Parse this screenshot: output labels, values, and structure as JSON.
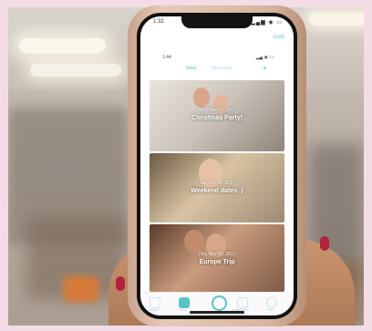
{
  "phone": {
    "status_time": "1:32",
    "status_icons": "▂▄▆ ◉ ▭",
    "top_right_link": "Lists",
    "inner_time": "1:44",
    "inner_status": "▂▄ ◉ ▭"
  },
  "tabs": [
    {
      "label": "Story"
    },
    {
      "label": "Memories"
    }
  ],
  "cards": [
    {
      "date": "Mon, Dec 25, 2017",
      "title": "Christmas Party!"
    },
    {
      "date": "Sat, Oct 14, 2017",
      "title": "Weekend dates :)"
    },
    {
      "date": "Thu, Nov 30, 2017",
      "title": "Europe Trip"
    }
  ],
  "bottom_nav": [
    {
      "label": "Home",
      "icon": "home-icon"
    },
    {
      "label": "Story",
      "icon": "story-icon"
    },
    {
      "label": "",
      "icon": "capture-icon"
    },
    {
      "label": "Notifications",
      "icon": "bell-icon"
    },
    {
      "label": "Me",
      "icon": "profile-icon"
    }
  ],
  "colors": {
    "accent": "#59c3c8",
    "nail_polish": "#b3233a",
    "border_pink": "#f3dce6"
  }
}
